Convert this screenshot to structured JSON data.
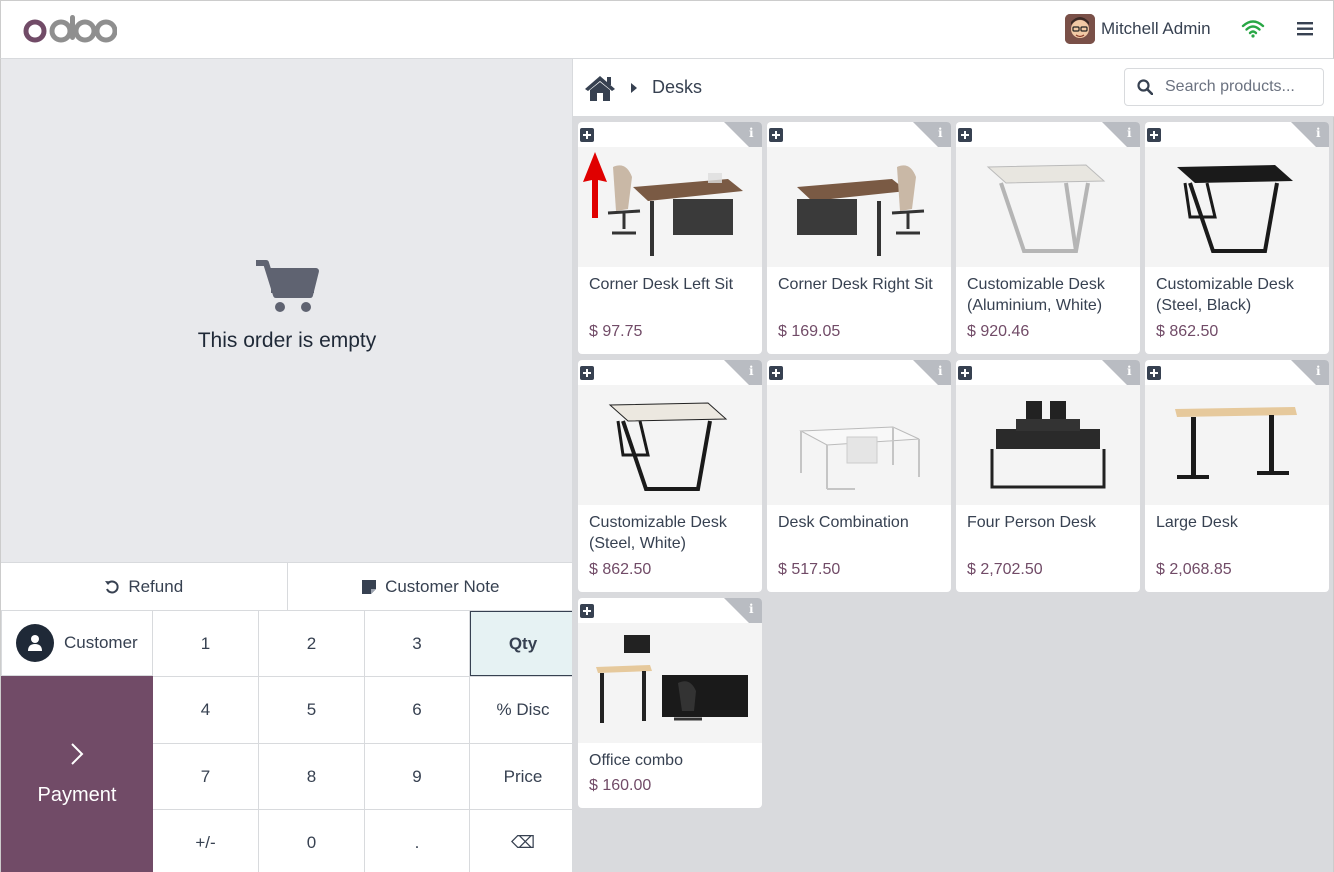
{
  "header": {
    "logo_text": "odoo",
    "user_name": "Mitchell Admin"
  },
  "order": {
    "empty_text": "This order is empty"
  },
  "actions": {
    "refund_label": "Refund",
    "note_label": "Customer Note"
  },
  "customer": {
    "label": "Customer"
  },
  "payment": {
    "label": "Payment"
  },
  "numpad": {
    "keys": [
      "1",
      "2",
      "3",
      "Qty",
      "4",
      "5",
      "6",
      "% Disc",
      "7",
      "8",
      "9",
      "Price",
      "+/-",
      "0",
      ".",
      "⌫"
    ]
  },
  "breadcrumb": {
    "category": "Desks"
  },
  "search": {
    "placeholder": "Search products..."
  },
  "products": [
    {
      "name": "Corner Desk Left Sit",
      "price": "$ 97.75"
    },
    {
      "name": "Corner Desk Right Sit",
      "price": "$ 169.05"
    },
    {
      "name": "Customizable Desk (Aluminium, White)",
      "price": "$ 920.46"
    },
    {
      "name": "Customizable Desk (Steel, Black)",
      "price": "$ 862.50"
    },
    {
      "name": "Customizable Desk (Steel, White)",
      "price": "$ 862.50"
    },
    {
      "name": "Desk Combination",
      "price": "$ 517.50"
    },
    {
      "name": "Four Person Desk",
      "price": "$ 2,702.50"
    },
    {
      "name": "Large Desk",
      "price": "$ 2,068.85"
    },
    {
      "name": "Office combo",
      "price": "$ 160.00"
    }
  ],
  "colors": {
    "brand": "#714b67",
    "active_key": "#e6f2f3",
    "wifi": "#28a745",
    "annotation_arrow": "#e00000"
  }
}
